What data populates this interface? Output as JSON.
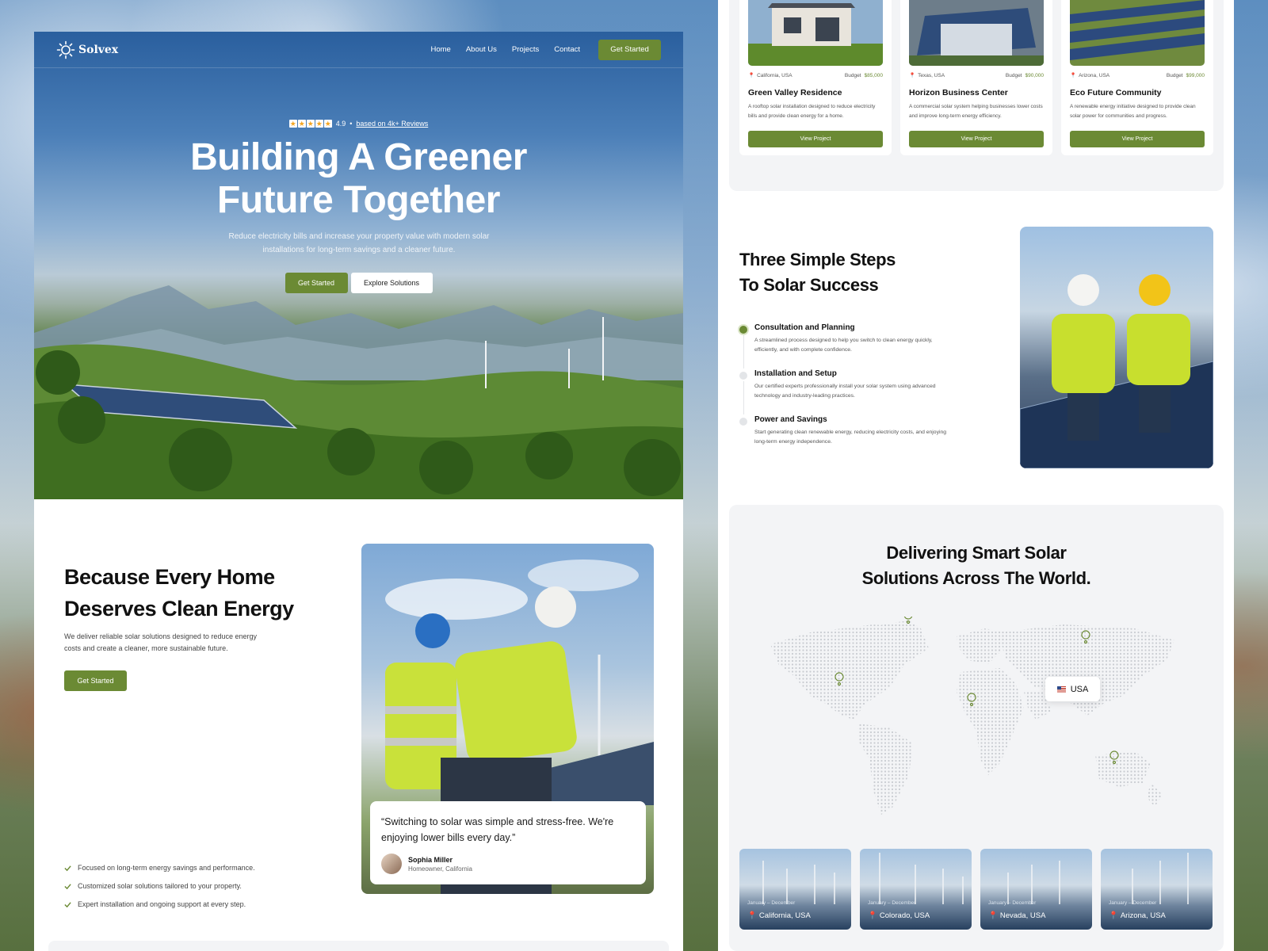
{
  "brand": {
    "name": "Solvex",
    "accent": "#6b8a34"
  },
  "nav": {
    "items": [
      "Home",
      "About Us",
      "Projects",
      "Contact"
    ],
    "cta": "Get Started"
  },
  "hero": {
    "rating_value": "4.9",
    "rating_sep": "•",
    "rating_link": "based on 4k+ Reviews",
    "star_count": 5,
    "title_line1": "Building A Greener",
    "title_line2": "Future Together",
    "subtitle": "Reduce electricity bills and increase your property value with modern solar installations for long-term savings and a cleaner future.",
    "primary_btn": "Get Started",
    "secondary_btn": "Explore Solutions"
  },
  "about": {
    "title_line1": "Because Every Home",
    "title_line2": "Deserves Clean Energy",
    "text": "We deliver reliable solar solutions designed to reduce energy costs and create a cleaner, more sustainable future.",
    "cta": "Get Started",
    "checks": [
      "Focused on long-term energy savings and performance.",
      "Customized solar solutions tailored to your property.",
      "Expert installation and ongoing support at every step."
    ],
    "quote": "“Switching to solar was simple and stress-free. We're enjoying lower bills every day.”",
    "author_name": "Sophia Miller",
    "author_role": "Homeowner, California"
  },
  "projects": [
    {
      "location": "California, USA",
      "budget_label": "Budget",
      "budget": "$85,000",
      "name": "Green Valley Residence",
      "desc": "A rooftop solar installation designed to reduce electricity bills and provide clean energy for a home.",
      "button": "View Project"
    },
    {
      "location": "Texas, USA",
      "budget_label": "Budget",
      "budget": "$90,000",
      "name": "Horizon Business Center",
      "desc": "A commercial solar system helping businesses lower costs and improve long-term energy efficiency.",
      "button": "View Project"
    },
    {
      "location": "Arizona, USA",
      "budget_label": "Budget",
      "budget": "$99,000",
      "name": "Eco Future Community",
      "desc": "A renewable energy initiative designed to provide clean solar power for communities and progress.",
      "button": "View Project"
    }
  ],
  "steps": {
    "title_line1": "Three Simple Steps",
    "title_line2": "To Solar Success",
    "items": [
      {
        "title": "Consultation and Planning",
        "desc": "A streamlined process designed to help you switch to clean energy quickly, efficiently, and with complete confidence.",
        "active": true
      },
      {
        "title": "Installation and Setup",
        "desc": "Our certified experts professionally install your solar system using advanced technology and industry-leading practices.",
        "active": false
      },
      {
        "title": "Power and Savings",
        "desc": "Start generating clean renewable energy, reducing electricity costs, and enjoying long-term energy independence.",
        "active": false
      }
    ]
  },
  "world": {
    "title_line1": "Delivering Smart Solar",
    "title_line2": "Solutions Across The World.",
    "tag": "USA",
    "locations": [
      {
        "date": "January – December",
        "city": "California, USA"
      },
      {
        "date": "January – December",
        "city": "Colorado, USA"
      },
      {
        "date": "January – December",
        "city": "Nevada, USA"
      },
      {
        "date": "January – December",
        "city": "Arizona, USA"
      }
    ]
  }
}
